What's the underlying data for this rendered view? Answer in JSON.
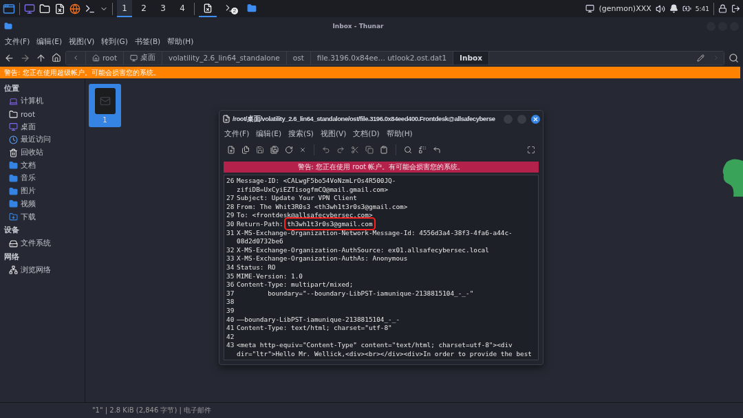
{
  "taskbar": {
    "workspaces": [
      {
        "label": "1",
        "selected": true
      },
      {
        "label": "2",
        "selected": false
      },
      {
        "label": "3",
        "selected": false
      },
      {
        "label": "4",
        "selected": false
      }
    ],
    "tasks": [
      {
        "selected": true
      },
      {
        "selected": false,
        "badge": "2"
      },
      {
        "selected": false
      }
    ],
    "genmon": "(genmon)XXX",
    "clock": "5:41"
  },
  "window": {
    "title": "Inbox - Thunar"
  },
  "menu": [
    "文件(F)",
    "编辑(E)",
    "视图(V)",
    "转到(G)",
    "书签(B)",
    "帮助(H)"
  ],
  "breadcrumbs": [
    {
      "label": "root",
      "selected": false
    },
    {
      "label": "桌面",
      "selected": false
    },
    {
      "label": "volatility_2.6_lin64_standalone",
      "selected": false
    },
    {
      "label": "ost",
      "selected": false
    },
    {
      "label": "file.3196.0x84ee… utlook2.ost.dat1",
      "selected": false
    },
    {
      "label": "Inbox",
      "selected": true
    }
  ],
  "warning": "警告: 您正在使用超级帐户。可能会损害您的系统。",
  "sidebar": [
    {
      "title": "位置",
      "items": [
        "计算机",
        "root",
        "桌面",
        "最近访问",
        "回收站",
        "文档",
        "音乐",
        "图片",
        "视频",
        "下载"
      ]
    },
    {
      "title": "设备",
      "items": [
        "文件系统"
      ]
    },
    {
      "title": "网络",
      "items": [
        "浏览网络"
      ]
    }
  ],
  "files": [
    {
      "name": "1",
      "selected": true
    }
  ],
  "status_bar": "\"1\" | 2.8 KiB (2,846 字节) | 电子邮件",
  "editor": {
    "title": "/root/桌面/volatility_2.6_lin64_standalone/ost/file.3196.0x84eed400.Frontdesk@allsafecyberse",
    "menu": [
      "文件(F)",
      "编辑(E)",
      "搜索(S)",
      "视图(V)",
      "文档(D)",
      "帮助(H)"
    ],
    "warning": "警告: 您正在使用 root 帐户。有可能会损害您的系统。",
    "lines": [
      {
        "n": "26",
        "text": "Message-ID: <CALwgF5bo54VoNzmLrOs4R500JQ-zifiDB=UxCyiEZTisogfmCQ@mail.gmail.com>"
      },
      {
        "n": "27",
        "text": "Subject: Update Your VPN Client"
      },
      {
        "n": "28",
        "text": "From: The Whit3R0s3 <th3wh1t3r0s3@gmail.com>"
      },
      {
        "n": "29",
        "text": "To: <frontdesk@allsafecybersec.com>"
      },
      {
        "n": "30",
        "text": "Return-Path: ",
        "mark": "th3wh1t3r0s3@gmail.com"
      },
      {
        "n": "31",
        "text": "X-MS-Exchange-Organization-Network-Message-Id: 4556d3a4-38f3-4fa6-a44c-08d2d0732be6"
      },
      {
        "n": "32",
        "text": "X-MS-Exchange-Organization-AuthSource: ex01.allsafecybersec.local"
      },
      {
        "n": "33",
        "text": "X-MS-Exchange-Organization-AuthAs: Anonymous"
      },
      {
        "n": "34",
        "text": "Status: RO"
      },
      {
        "n": "35",
        "text": "MIME-Version: 1.0"
      },
      {
        "n": "36",
        "text": "Content-Type: multipart/mixed;"
      },
      {
        "n": "37",
        "text": "        boundary=\"--boundary-LibPST-iamunique-2138815104_-_-\""
      },
      {
        "n": "38"
      },
      {
        "n": "39"
      },
      {
        "n": "40",
        "text": "——boundary-LibPST-iamunique-2138815104_-_-"
      },
      {
        "n": "41",
        "text": "Content-Type: text/html; charset=\"utf-8\""
      },
      {
        "n": "42"
      },
      {
        "n": "43",
        "text": "<meta http-equiv=\"Content-Type\" content=\"text/html; charset=utf-8\"><div dir=\"ltr\">Hello Mr. Wellick,<div><br></div><div>In order to provide the best"
      }
    ]
  }
}
